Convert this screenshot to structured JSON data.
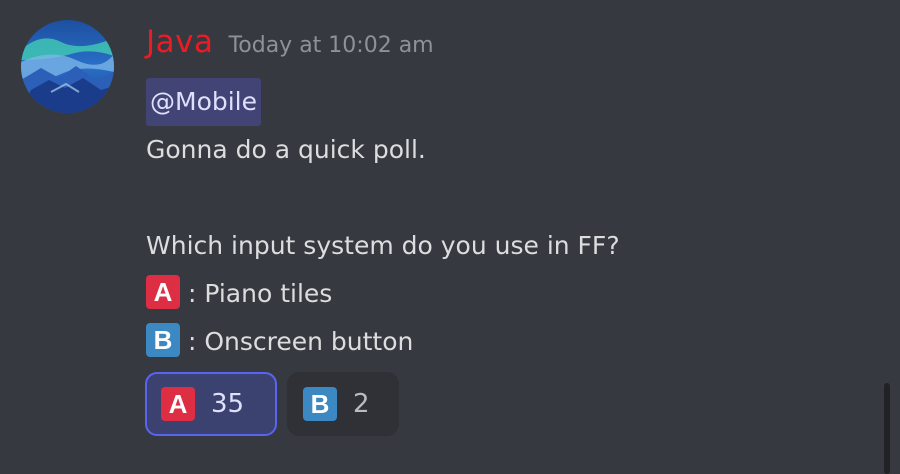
{
  "message": {
    "username": "Java",
    "timestamp": "Today at 10:02 am",
    "username_color": "#ed1b24",
    "mention": "@Mobile",
    "lines": {
      "intro": "Gonna do a quick poll.",
      "question": "Which input system do you use in FF?",
      "option_a_emoji": "A",
      "option_a_text": " : Piano tiles",
      "option_b_emoji": "B",
      "option_b_text": " : Onscreen button"
    }
  },
  "reactions": [
    {
      "emoji": "A",
      "count": "35",
      "selected": true
    },
    {
      "emoji": "B",
      "count": "2",
      "selected": false
    }
  ],
  "avatar": {
    "icon": "landscape-avatar"
  },
  "colors": {
    "background": "#36393f",
    "mention_bg": "#414475",
    "reaction_active_border": "#5865f2",
    "emoji_a": "#dd2e44",
    "emoji_b": "#3b88c3"
  }
}
